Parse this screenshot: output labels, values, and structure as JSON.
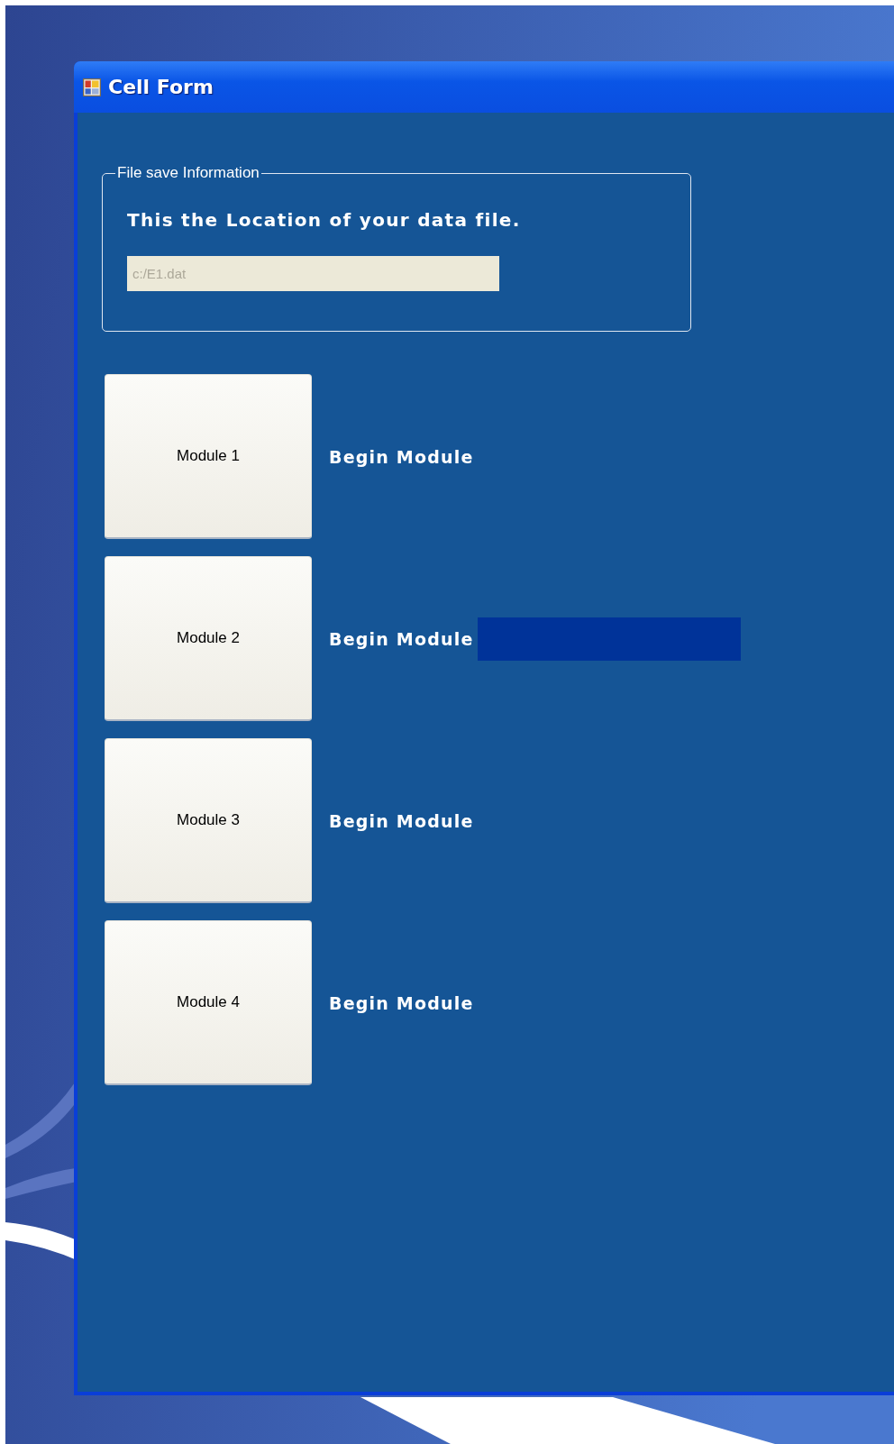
{
  "window": {
    "title": "Cell Form"
  },
  "group": {
    "legend": "File save Information",
    "heading": "This the Location of your data file.",
    "file_field": {
      "value": "c:/E1.dat",
      "disabled": true
    }
  },
  "modules": [
    {
      "button": "Module 1",
      "label": "Begin Module",
      "highlight": false
    },
    {
      "button": "Module 2",
      "label": "Begin Module",
      "highlight": true
    },
    {
      "button": "Module 3",
      "label": "Begin Module",
      "highlight": false
    },
    {
      "button": "Module 4",
      "label": "Begin Module",
      "highlight": false
    }
  ]
}
